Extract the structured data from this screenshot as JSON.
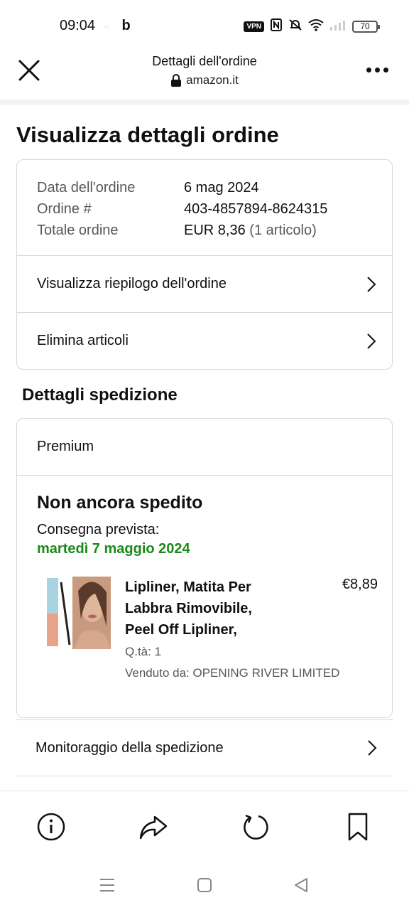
{
  "status_bar": {
    "time": "09:04",
    "app_icons": "b",
    "vpn": "VPN",
    "battery": "70"
  },
  "browser": {
    "title": "Dettagli dell'ordine",
    "url": "amazon.it"
  },
  "page": {
    "title": "Visualizza dettagli ordine"
  },
  "order": {
    "rows": [
      {
        "label": "Data dell'ordine",
        "value": "6 mag 2024"
      },
      {
        "label": "Ordine #",
        "value": "403-4857894-8624315"
      },
      {
        "label": "Totale ordine",
        "value": "EUR 8,36",
        "extra": "(1 articolo)"
      }
    ],
    "links": [
      {
        "label": "Visualizza riepilogo dell'ordine"
      },
      {
        "label": "Elimina articoli"
      }
    ]
  },
  "shipping": {
    "section_title": "Dettagli spedizione",
    "tier": "Premium",
    "status": "Non ancora spedito",
    "expected_label": "Consegna prevista:",
    "expected_date": "martedì 7 maggio 2024",
    "product": {
      "title": "Lipliner, Matita Per Labbra Rimovibile, Peel Off Lipliner,",
      "price": "€8,89",
      "qty": "Q.tà: 1",
      "seller": "Venduto da: OPENING RIVER LIMITED"
    },
    "tracking_label": "Monitoraggio della spedizione"
  },
  "colors": {
    "accent_green": "#1a8a1a",
    "border": "#d5d9d9",
    "muted_text": "#565959"
  }
}
